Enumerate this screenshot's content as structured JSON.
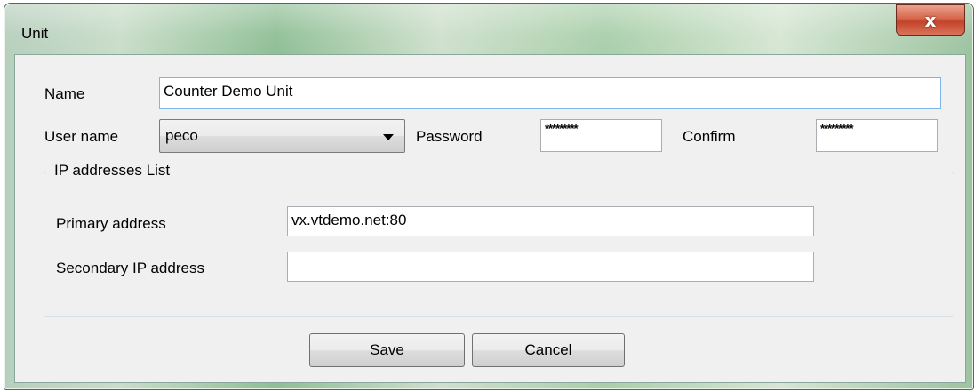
{
  "window": {
    "title": "Unit",
    "close_label": "x"
  },
  "form": {
    "name_label": "Name",
    "name_value": "Counter Demo Unit",
    "username_label": "User name",
    "username_value": "peco",
    "password_label": "Password",
    "password_value": "*********",
    "confirm_label": "Confirm",
    "confirm_value": "*********"
  },
  "ip_group": {
    "legend": "IP addresses List",
    "primary_label": "Primary address",
    "primary_value": "vx.vtdemo.net:80",
    "secondary_label": "Secondary IP address",
    "secondary_value": ""
  },
  "buttons": {
    "save_label": "Save",
    "cancel_label": "Cancel"
  }
}
